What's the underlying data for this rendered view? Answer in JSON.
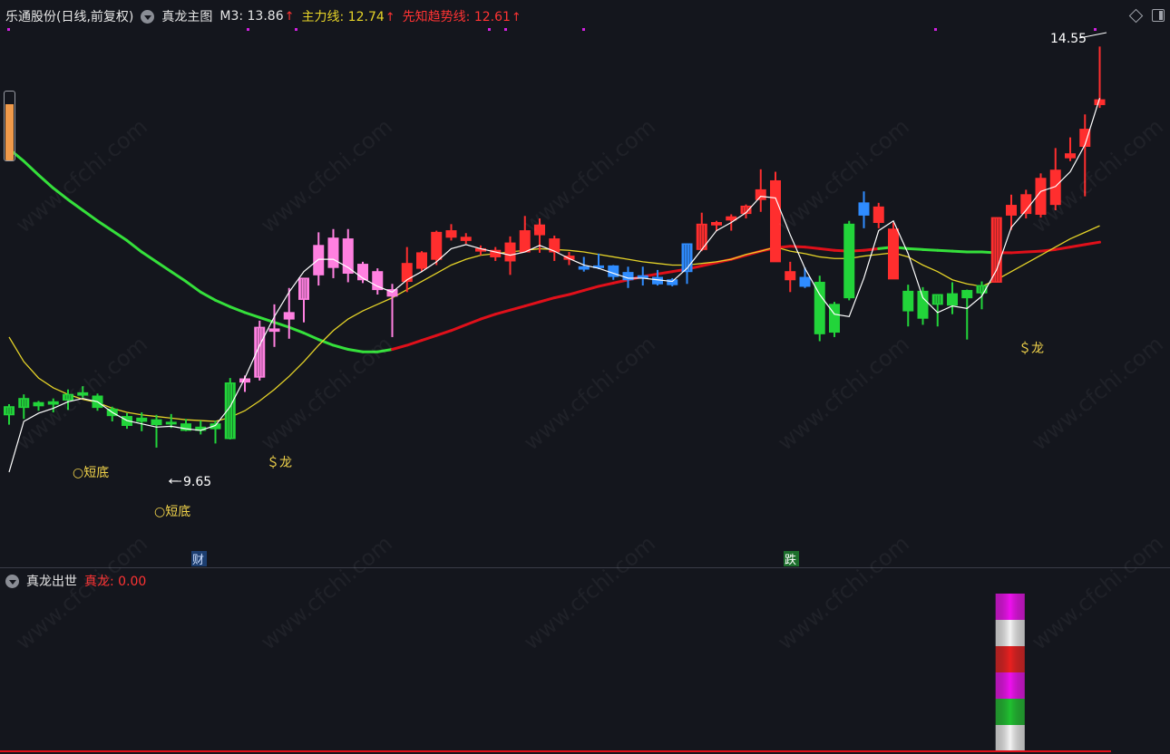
{
  "header": {
    "stock_name": "乐通股份(日线,前复权)",
    "indicator_name": "真龙主图",
    "m3_label": "M3: 13.86",
    "zhuli_label": "主力线: 12.74",
    "xianzhi_label": "先知趋势线: 12.61",
    "arrow": "↑"
  },
  "colors": {
    "up": "#ff2e2e",
    "down": "#22d43a",
    "pink": "#ff80e0",
    "blue": "#2f8cff",
    "yellow_line": "#e5d328",
    "white_line": "#ffffff",
    "trend_red": "#e0101a",
    "trend_green": "#35e03b",
    "label_yellow": "#f0d24a",
    "magenta_dot": "#d020e0"
  },
  "annotations": {
    "high_label": "14.55",
    "low_label": "9.65",
    "short_bottom": "○短底",
    "dragon": "＄龙",
    "badge_cai": "财",
    "badge_die": "跌",
    "watermark": "www.cfchi.com"
  },
  "sub_panel": {
    "indicator_name": "真龙出世",
    "value_label": "真龙: 0.00"
  },
  "chart_data": {
    "type": "candlestick",
    "yaxis": {
      "min": 9.25,
      "max": 14.72,
      "unit": "CNY"
    },
    "candles": [
      {
        "o": 10.05,
        "h": 10.18,
        "l": 9.93,
        "c": 10.15,
        "color": "down"
      },
      {
        "o": 10.14,
        "h": 10.3,
        "l": 10.0,
        "c": 10.25,
        "color": "down"
      },
      {
        "o": 10.16,
        "h": 10.22,
        "l": 10.1,
        "c": 10.2,
        "color": "down"
      },
      {
        "o": 10.18,
        "h": 10.25,
        "l": 10.08,
        "c": 10.21,
        "color": "down"
      },
      {
        "o": 10.23,
        "h": 10.36,
        "l": 10.11,
        "c": 10.3,
        "color": "down"
      },
      {
        "o": 10.32,
        "h": 10.4,
        "l": 10.26,
        "c": 10.29,
        "color": "down"
      },
      {
        "o": 10.28,
        "h": 10.31,
        "l": 10.1,
        "c": 10.14,
        "color": "down"
      },
      {
        "o": 10.12,
        "h": 10.15,
        "l": 9.97,
        "c": 10.04,
        "color": "down"
      },
      {
        "o": 10.03,
        "h": 10.07,
        "l": 9.88,
        "c": 9.92,
        "color": "down"
      },
      {
        "o": 9.97,
        "h": 10.08,
        "l": 9.85,
        "c": 10.01,
        "color": "down"
      },
      {
        "o": 9.99,
        "h": 10.05,
        "l": 9.65,
        "c": 9.93,
        "color": "down"
      },
      {
        "o": 9.94,
        "h": 10.06,
        "l": 9.89,
        "c": 9.96,
        "color": "down"
      },
      {
        "o": 9.94,
        "h": 10.0,
        "l": 9.85,
        "c": 9.86,
        "color": "down"
      },
      {
        "o": 9.9,
        "h": 9.98,
        "l": 9.81,
        "c": 9.86,
        "color": "down"
      },
      {
        "o": 9.88,
        "h": 9.98,
        "l": 9.7,
        "c": 9.94,
        "color": "down"
      },
      {
        "o": 9.76,
        "h": 10.5,
        "l": 9.75,
        "c": 10.44,
        "color": "down"
      },
      {
        "o": 10.45,
        "h": 10.53,
        "l": 10.33,
        "c": 10.49,
        "color": "pink"
      },
      {
        "o": 10.51,
        "h": 11.2,
        "l": 10.47,
        "c": 11.12,
        "color": "pink"
      },
      {
        "o": 11.07,
        "h": 11.4,
        "l": 10.88,
        "c": 11.1,
        "color": "pink"
      },
      {
        "o": 11.3,
        "h": 11.6,
        "l": 10.98,
        "c": 11.22,
        "color": "pink"
      },
      {
        "o": 11.46,
        "h": 11.65,
        "l": 11.18,
        "c": 11.72,
        "color": "pink"
      },
      {
        "o": 12.12,
        "h": 12.28,
        "l": 11.63,
        "c": 11.76,
        "color": "pink"
      },
      {
        "o": 12.21,
        "h": 12.32,
        "l": 11.72,
        "c": 11.85,
        "color": "pink"
      },
      {
        "o": 12.2,
        "h": 12.32,
        "l": 11.67,
        "c": 11.78,
        "color": "pink"
      },
      {
        "o": 11.89,
        "h": 11.92,
        "l": 11.66,
        "c": 11.7,
        "color": "pink"
      },
      {
        "o": 11.8,
        "h": 11.84,
        "l": 11.52,
        "c": 11.58,
        "color": "pink"
      },
      {
        "o": 11.58,
        "h": 11.65,
        "l": 11.0,
        "c": 11.5,
        "color": "pink"
      },
      {
        "o": 11.9,
        "h": 12.1,
        "l": 11.55,
        "c": 11.68,
        "color": "up"
      },
      {
        "o": 12.03,
        "h": 12.05,
        "l": 11.8,
        "c": 11.84,
        "color": "up"
      },
      {
        "o": 12.28,
        "h": 12.3,
        "l": 11.88,
        "c": 11.95,
        "color": "up"
      },
      {
        "o": 12.3,
        "h": 12.38,
        "l": 12.18,
        "c": 12.22,
        "color": "up"
      },
      {
        "o": 12.22,
        "h": 12.27,
        "l": 12.14,
        "c": 12.18,
        "color": "up"
      },
      {
        "o": 12.08,
        "h": 12.12,
        "l": 12.0,
        "c": 12.05,
        "color": "up"
      },
      {
        "o": 12.06,
        "h": 12.1,
        "l": 11.93,
        "c": 11.98,
        "color": "up"
      },
      {
        "o": 12.15,
        "h": 12.23,
        "l": 11.76,
        "c": 11.93,
        "color": "up"
      },
      {
        "o": 12.3,
        "h": 12.48,
        "l": 12.08,
        "c": 12.04,
        "color": "up"
      },
      {
        "o": 12.37,
        "h": 12.45,
        "l": 12.03,
        "c": 12.25,
        "color": "up"
      },
      {
        "o": 12.2,
        "h": 12.24,
        "l": 11.93,
        "c": 12.04,
        "color": "up"
      },
      {
        "o": 11.99,
        "h": 12.04,
        "l": 11.88,
        "c": 11.95,
        "color": "up"
      },
      {
        "o": 11.86,
        "h": 11.98,
        "l": 11.8,
        "c": 11.83,
        "color": "blue"
      },
      {
        "o": 11.86,
        "h": 12.02,
        "l": 11.83,
        "c": 11.87,
        "color": "blue"
      },
      {
        "o": 11.87,
        "h": 11.88,
        "l": 11.7,
        "c": 11.74,
        "color": "blue"
      },
      {
        "o": 11.79,
        "h": 11.86,
        "l": 11.6,
        "c": 11.7,
        "color": "blue"
      },
      {
        "o": 11.75,
        "h": 11.86,
        "l": 11.63,
        "c": 11.72,
        "color": "blue"
      },
      {
        "o": 11.73,
        "h": 11.82,
        "l": 11.63,
        "c": 11.65,
        "color": "blue"
      },
      {
        "o": 11.64,
        "h": 11.72,
        "l": 11.62,
        "c": 11.7,
        "color": "blue"
      },
      {
        "o": 11.8,
        "h": 12.12,
        "l": 11.65,
        "c": 12.14,
        "color": "blue"
      },
      {
        "o": 12.07,
        "h": 12.52,
        "l": 12.05,
        "c": 12.38,
        "color": "up"
      },
      {
        "o": 12.37,
        "h": 12.42,
        "l": 12.3,
        "c": 12.4,
        "color": "up"
      },
      {
        "o": 12.43,
        "h": 12.5,
        "l": 12.3,
        "c": 12.47,
        "color": "up"
      },
      {
        "o": 12.51,
        "h": 12.62,
        "l": 12.45,
        "c": 12.6,
        "color": "up"
      },
      {
        "o": 12.8,
        "h": 13.05,
        "l": 12.53,
        "c": 12.68,
        "color": "up"
      },
      {
        "o": 12.91,
        "h": 13.02,
        "l": 11.93,
        "c": 11.92,
        "color": "up"
      },
      {
        "o": 11.8,
        "h": 11.92,
        "l": 11.55,
        "c": 11.7,
        "color": "up"
      },
      {
        "o": 11.73,
        "h": 11.85,
        "l": 11.6,
        "c": 11.62,
        "color": "blue"
      },
      {
        "o": 11.67,
        "h": 11.75,
        "l": 10.95,
        "c": 11.04,
        "color": "down"
      },
      {
        "o": 11.4,
        "h": 11.43,
        "l": 11.0,
        "c": 11.06,
        "color": "down"
      },
      {
        "o": 12.38,
        "h": 12.42,
        "l": 11.45,
        "c": 11.48,
        "color": "down"
      },
      {
        "o": 12.64,
        "h": 12.78,
        "l": 12.33,
        "c": 12.49,
        "color": "blue"
      },
      {
        "o": 12.59,
        "h": 12.64,
        "l": 12.33,
        "c": 12.4,
        "color": "up"
      },
      {
        "o": 12.32,
        "h": 12.4,
        "l": 11.75,
        "c": 11.71,
        "color": "up"
      },
      {
        "o": 11.56,
        "h": 11.64,
        "l": 11.13,
        "c": 11.32,
        "color": "down"
      },
      {
        "o": 11.56,
        "h": 11.61,
        "l": 11.15,
        "c": 11.23,
        "color": "down"
      },
      {
        "o": 11.4,
        "h": 11.5,
        "l": 11.13,
        "c": 11.52,
        "color": "down"
      },
      {
        "o": 11.53,
        "h": 11.67,
        "l": 11.28,
        "c": 11.39,
        "color": "down"
      },
      {
        "o": 11.57,
        "h": 11.58,
        "l": 10.97,
        "c": 11.48,
        "color": "down"
      },
      {
        "o": 11.54,
        "h": 11.68,
        "l": 11.34,
        "c": 11.63,
        "color": "down"
      },
      {
        "o": 11.67,
        "h": 12.46,
        "l": 11.67,
        "c": 12.46,
        "color": "up"
      },
      {
        "o": 12.61,
        "h": 12.74,
        "l": 12.31,
        "c": 12.49,
        "color": "up"
      },
      {
        "o": 12.74,
        "h": 12.8,
        "l": 12.45,
        "c": 12.51,
        "color": "up"
      },
      {
        "o": 12.94,
        "h": 13.0,
        "l": 12.46,
        "c": 12.5,
        "color": "up"
      },
      {
        "o": 13.04,
        "h": 13.31,
        "l": 12.55,
        "c": 12.62,
        "color": "up"
      },
      {
        "o": 13.24,
        "h": 13.44,
        "l": 13.15,
        "c": 13.19,
        "color": "up"
      },
      {
        "o": 13.54,
        "h": 13.72,
        "l": 12.72,
        "c": 13.33,
        "color": "up"
      },
      {
        "o": 13.9,
        "h": 14.55,
        "l": 13.8,
        "c": 13.84,
        "color": "up"
      }
    ],
    "series": [
      {
        "name": "M3",
        "color": "#ffffff",
        "values": [
          9.35,
          9.97,
          10.07,
          10.13,
          10.21,
          10.25,
          10.21,
          10.08,
          9.98,
          9.94,
          9.9,
          9.91,
          9.88,
          9.86,
          9.92,
          10.15,
          10.5,
          10.9,
          11.25,
          11.55,
          11.8,
          11.95,
          11.95,
          11.85,
          11.72,
          11.62,
          11.55,
          11.7,
          11.8,
          11.92,
          12.08,
          12.13,
          12.08,
          12.04,
          12.0,
          12.04,
          12.12,
          12.05,
          11.96,
          11.88,
          11.84,
          11.78,
          11.72,
          11.72,
          11.7,
          11.68,
          11.84,
          12.07,
          12.3,
          12.4,
          12.52,
          12.72,
          12.7,
          12.25,
          11.84,
          11.52,
          11.28,
          11.25,
          11.72,
          12.3,
          12.42,
          12.02,
          11.48,
          11.3,
          11.38,
          11.35,
          11.5,
          11.82,
          12.34,
          12.55,
          12.78,
          12.84,
          13.02,
          13.35,
          13.92
        ]
      },
      {
        "name": "主力线",
        "color": "#e5d328",
        "values": [
          11.0,
          10.7,
          10.5,
          10.38,
          10.3,
          10.24,
          10.2,
          10.13,
          10.08,
          10.05,
          10.03,
          10.01,
          9.99,
          9.98,
          9.97,
          10.02,
          10.1,
          10.22,
          10.36,
          10.52,
          10.7,
          10.9,
          11.08,
          11.22,
          11.32,
          11.4,
          11.48,
          11.58,
          11.68,
          11.78,
          11.88,
          11.95,
          12.0,
          12.02,
          12.04,
          12.06,
          12.08,
          12.07,
          12.06,
          12.04,
          12.01,
          11.98,
          11.95,
          11.92,
          11.9,
          11.88,
          11.88,
          11.9,
          11.92,
          11.95,
          12.01,
          12.05,
          12.1,
          12.05,
          12.02,
          11.98,
          11.96,
          11.96,
          11.99,
          12.01,
          12.03,
          11.98,
          11.88,
          11.8,
          11.7,
          11.65,
          11.62,
          11.7,
          11.8,
          11.9,
          12.0,
          12.1,
          12.2,
          12.28,
          12.36
        ]
      },
      {
        "name": "先知趋势线",
        "colors": [
          "#35e03b",
          "#e0101a"
        ],
        "values": [
          13.3,
          13.15,
          12.98,
          12.82,
          12.68,
          12.55,
          12.42,
          12.3,
          12.18,
          12.04,
          11.92,
          11.8,
          11.68,
          11.55,
          11.45,
          11.37,
          11.3,
          11.24,
          11.18,
          11.12,
          11.05,
          10.97,
          10.9,
          10.85,
          10.82,
          10.82,
          10.85,
          10.9,
          10.96,
          11.02,
          11.08,
          11.15,
          11.22,
          11.28,
          11.33,
          11.38,
          11.43,
          11.48,
          11.52,
          11.57,
          11.62,
          11.66,
          11.7,
          11.74,
          11.77,
          11.8,
          11.83,
          11.87,
          11.91,
          11.95,
          12.0,
          12.05,
          12.09,
          12.11,
          12.1,
          12.08,
          12.06,
          12.05,
          12.06,
          12.08,
          12.1,
          12.08,
          12.07,
          12.06,
          12.05,
          12.04,
          12.04,
          12.03,
          12.03,
          12.04,
          12.05,
          12.07,
          12.1,
          12.13,
          12.16
        ],
        "color_switch_index": [
          19,
          56
        ]
      }
    ],
    "sub_bar": {
      "values": [
        1,
        1,
        1,
        1,
        1,
        1
      ],
      "segment_colors": [
        "#ee10ee",
        "#f4f4f4",
        "#e82020",
        "#ee10ee",
        "#20c030",
        "#f4f4f4"
      ],
      "at_candle": 67
    }
  }
}
